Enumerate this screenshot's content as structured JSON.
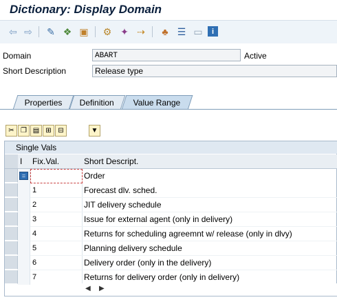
{
  "window": {
    "title": "Dictionary: Display Domain"
  },
  "toolbar": {
    "icons": [
      "back-arrow-icon",
      "forward-arrow-icon",
      "display-change-icon",
      "other-object-icon",
      "activate-icon",
      "where-used-icon",
      "object-list-icon",
      "navigate-icon",
      "hierarchy-icon",
      "check-icon",
      "layout-icon",
      "info-icon"
    ]
  },
  "form": {
    "domain_label": "Domain",
    "domain_value": "ABART",
    "status_value": "Active",
    "short_desc_label": "Short Description",
    "short_desc_value": "Release type"
  },
  "tabs": [
    {
      "label": "Properties"
    },
    {
      "label": "Definition"
    },
    {
      "label": "Value Range"
    }
  ],
  "table": {
    "section_title": "Single Vals",
    "headers": {
      "indicator": "I",
      "fix_val": "Fix.Val.",
      "short_descript": "Short Descript."
    },
    "rows": [
      {
        "fix_val": "",
        "desc": "Order"
      },
      {
        "fix_val": "1",
        "desc": "Forecast dlv. sched."
      },
      {
        "fix_val": "2",
        "desc": "JIT delivery schedule"
      },
      {
        "fix_val": "3",
        "desc": "Issue for external agent (only in delivery)"
      },
      {
        "fix_val": "4",
        "desc": "Returns for scheduling agreemnt w/ release (only in dlvy)"
      },
      {
        "fix_val": "5",
        "desc": "Planning delivery schedule"
      },
      {
        "fix_val": "6",
        "desc": "Delivery order (only in the delivery)"
      },
      {
        "fix_val": "7",
        "desc": "Returns for delivery order (only in delivery)"
      }
    ]
  },
  "colors": {
    "accent": "#0a1f3c",
    "toolbar_bg": "#eef4f9",
    "tab_active": "#c9dced"
  }
}
